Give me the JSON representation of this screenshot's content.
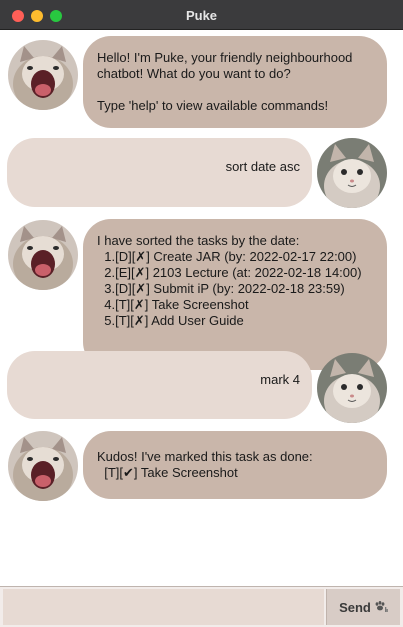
{
  "window": {
    "title": "Puke"
  },
  "messages": [
    {
      "sender": "bot",
      "text": "Hello! I'm Puke, your friendly neighbourhood chatbot! What do you want to do?\n\nType 'help' to view available commands!"
    },
    {
      "sender": "user",
      "text": "sort date asc"
    },
    {
      "sender": "bot",
      "text": "I have sorted the tasks by the date:\n  1.[D][✗] Create JAR (by: 2022-02-17 22:00)\n  2.[E][✗] 2103 Lecture (at: 2022-02-18 14:00)\n  3.[D][✗] Submit iP (by: 2022-02-18 23:59)\n  4.[T][✗] Take Screenshot\n  5.[T][✗] Add User Guide"
    },
    {
      "sender": "user",
      "text": "mark 4"
    },
    {
      "sender": "bot",
      "text": "Kudos! I've marked this task as done:\n  [T][✔] Take Screenshot"
    }
  ],
  "input": {
    "value": "",
    "placeholder": ""
  },
  "send_button": {
    "label": "Send",
    "icon": "paw-icon"
  }
}
